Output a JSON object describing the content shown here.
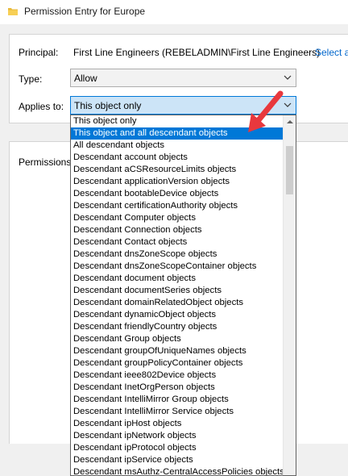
{
  "window": {
    "title": "Permission Entry for Europe"
  },
  "principal": {
    "label": "Principal:",
    "value": "First Line Engineers (REBELADMIN\\First Line Engineers)",
    "select_link": "Select a"
  },
  "type": {
    "label": "Type:",
    "value": "Allow"
  },
  "applies_to": {
    "label": "Applies to:",
    "value": "This object only",
    "options": [
      "This object only",
      "This object and all descendant objects",
      "All descendant objects",
      "Descendant account objects",
      "Descendant aCSResourceLimits objects",
      "Descendant applicationVersion objects",
      "Descendant bootableDevice objects",
      "Descendant certificationAuthority objects",
      "Descendant Computer objects",
      "Descendant Connection objects",
      "Descendant Contact objects",
      "Descendant dnsZoneScope objects",
      "Descendant dnsZoneScopeContainer objects",
      "Descendant document objects",
      "Descendant documentSeries objects",
      "Descendant domainRelatedObject objects",
      "Descendant dynamicObject objects",
      "Descendant friendlyCountry objects",
      "Descendant Group objects",
      "Descendant groupOfUniqueNames objects",
      "Descendant groupPolicyContainer objects",
      "Descendant ieee802Device objects",
      "Descendant InetOrgPerson objects",
      "Descendant IntelliMirror Group objects",
      "Descendant IntelliMirror Service objects",
      "Descendant ipHost objects",
      "Descendant ipNetwork objects",
      "Descendant ipProtocol objects",
      "Descendant ipService objects",
      "Descendant msAuthz-CentralAccessPolicies objects"
    ],
    "highlighted_option": "This object and all descendant objects"
  },
  "permissions": {
    "label": "Permissions:"
  },
  "colors": {
    "highlight": "#0078d7",
    "link": "#0066cc",
    "annotation_arrow": "#e8383d"
  },
  "icons": {
    "title": "folder-icon",
    "combo": "chevron-down-icon",
    "scroll": "scroll-up-arrow-icon",
    "annotation": "red-arrow-icon"
  }
}
